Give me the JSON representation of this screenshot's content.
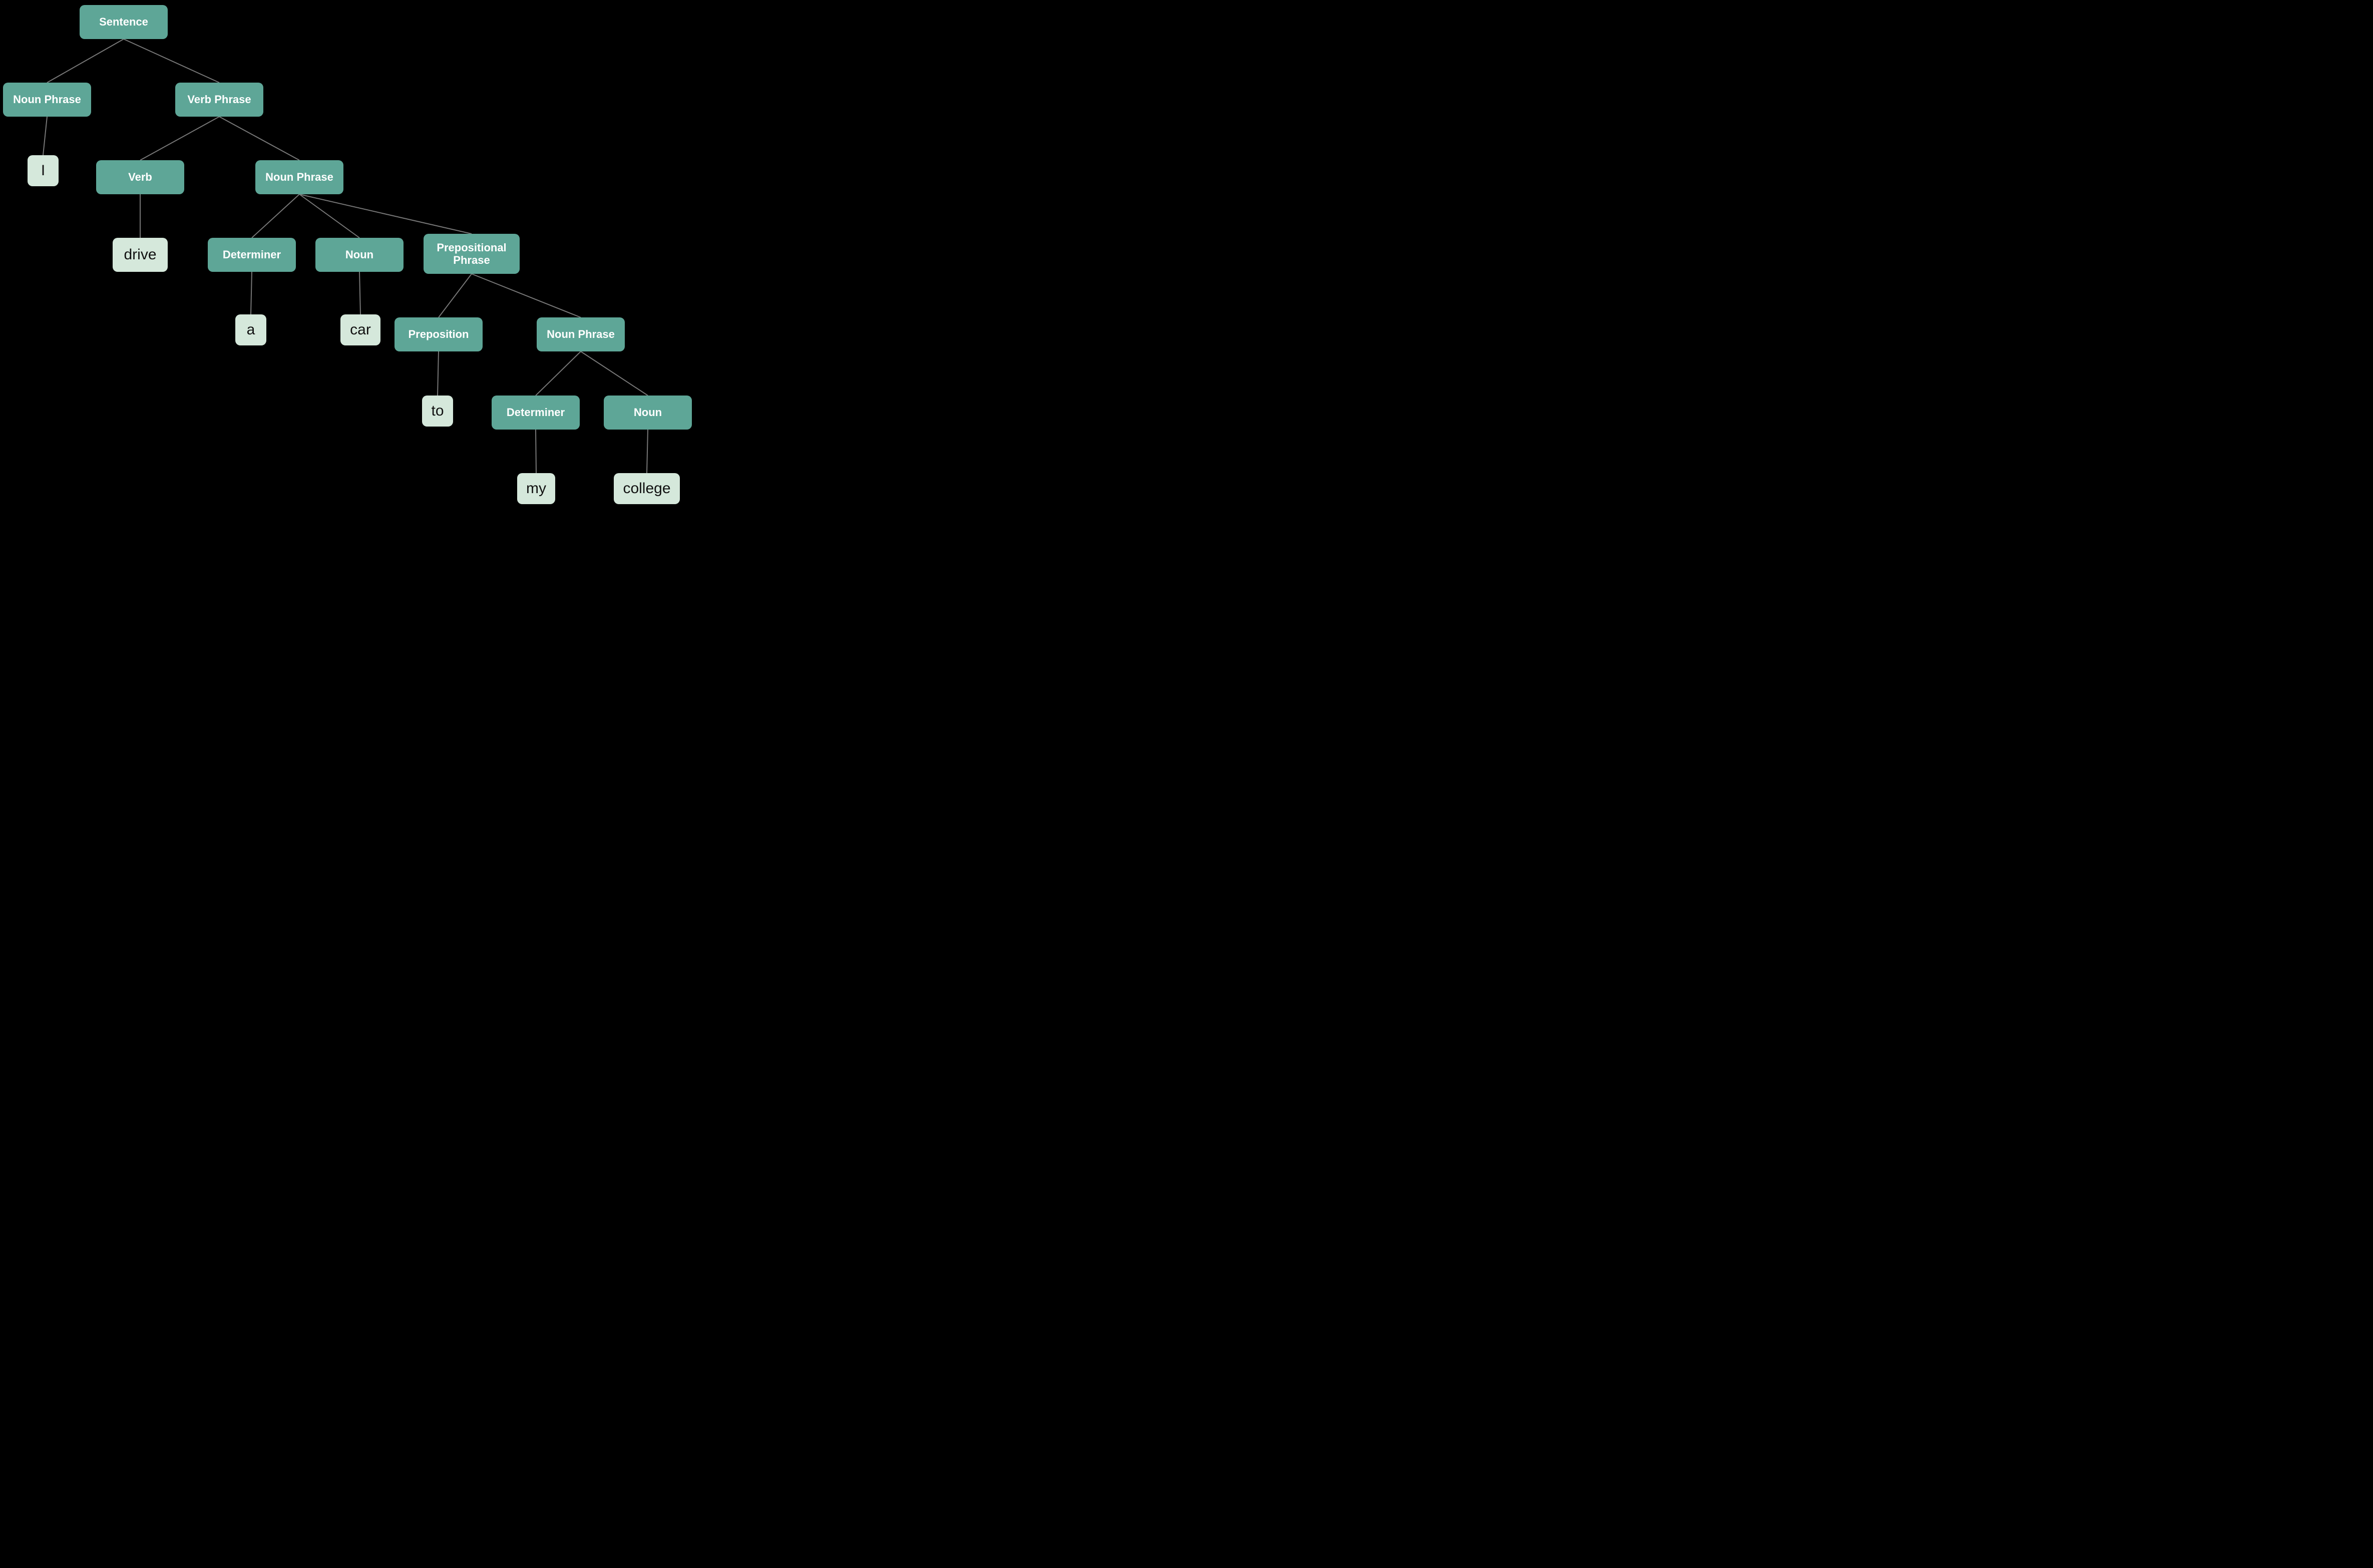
{
  "colors": {
    "category_bg": "#5ea697",
    "category_fg": "#ffffff",
    "leaf_bg": "#d5e8db",
    "leaf_fg": "#111111",
    "page_bg": "#000000",
    "edge": "#777777"
  },
  "tree": {
    "sentence_text": "I drive a car to my college",
    "root": "Sentence",
    "nodes": {
      "sentence": {
        "label": "Sentence",
        "kind": "category"
      },
      "np1": {
        "label": "Noun Phrase",
        "kind": "category"
      },
      "vp": {
        "label": "Verb Phrase",
        "kind": "category"
      },
      "I": {
        "label": "I",
        "kind": "leaf"
      },
      "verb": {
        "label": "Verb",
        "kind": "category"
      },
      "np2": {
        "label": "Noun Phrase",
        "kind": "category"
      },
      "drive": {
        "label": "drive",
        "kind": "leaf"
      },
      "det1": {
        "label": "Determiner",
        "kind": "category"
      },
      "noun1": {
        "label": "Noun",
        "kind": "category"
      },
      "pp": {
        "label": "Prepositional Phrase",
        "kind": "category"
      },
      "a": {
        "label": "a",
        "kind": "leaf"
      },
      "car": {
        "label": "car",
        "kind": "leaf"
      },
      "prep": {
        "label": "Preposition",
        "kind": "category"
      },
      "np3": {
        "label": "Noun Phrase",
        "kind": "category"
      },
      "to": {
        "label": "to",
        "kind": "leaf"
      },
      "det2": {
        "label": "Determiner",
        "kind": "category"
      },
      "noun2": {
        "label": "Noun",
        "kind": "category"
      },
      "my": {
        "label": "my",
        "kind": "leaf"
      },
      "college": {
        "label": "college",
        "kind": "leaf"
      }
    },
    "edges": [
      [
        "sentence",
        "np1"
      ],
      [
        "sentence",
        "vp"
      ],
      [
        "np1",
        "I"
      ],
      [
        "vp",
        "verb"
      ],
      [
        "vp",
        "np2"
      ],
      [
        "verb",
        "drive"
      ],
      [
        "np2",
        "det1"
      ],
      [
        "np2",
        "noun1"
      ],
      [
        "np2",
        "pp"
      ],
      [
        "det1",
        "a"
      ],
      [
        "noun1",
        "car"
      ],
      [
        "pp",
        "prep"
      ],
      [
        "pp",
        "np3"
      ],
      [
        "prep",
        "to"
      ],
      [
        "np3",
        "det2"
      ],
      [
        "np3",
        "noun2"
      ],
      [
        "det2",
        "my"
      ],
      [
        "noun2",
        "college"
      ]
    ]
  }
}
